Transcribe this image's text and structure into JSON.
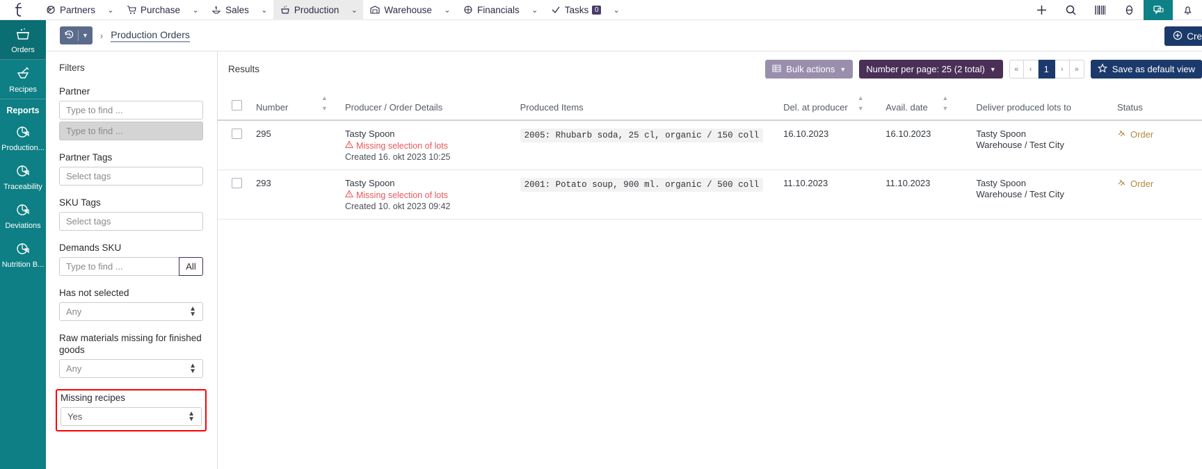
{
  "topbar": {
    "brand": "t",
    "menus": [
      {
        "label": "Partners",
        "icon": "partners-icon",
        "caret": true,
        "active": false
      },
      {
        "label": "Purchase",
        "icon": "cart-icon",
        "caret": true,
        "active": false
      },
      {
        "label": "Sales",
        "icon": "sales-icon",
        "caret": true,
        "active": false
      },
      {
        "label": "Production",
        "icon": "production-icon",
        "caret": true,
        "active": true
      },
      {
        "label": "Warehouse",
        "icon": "warehouse-icon",
        "caret": true,
        "active": false
      },
      {
        "label": "Financials",
        "icon": "financials-icon",
        "caret": true,
        "active": false
      },
      {
        "label": "Tasks",
        "icon": "check-icon",
        "caret": true,
        "active": false,
        "badge": "0"
      }
    ],
    "right_icons": [
      {
        "name": "plus-icon",
        "glyph": "+",
        "highlight": false
      },
      {
        "name": "search-icon",
        "glyph": "⌕",
        "highlight": false
      },
      {
        "name": "barcode-icon",
        "glyph": "▥",
        "highlight": false
      },
      {
        "name": "help-icon",
        "glyph": "◍",
        "highlight": false
      },
      {
        "name": "chat-icon",
        "glyph": "▢",
        "highlight": true
      },
      {
        "name": "bell-icon",
        "glyph": "◔",
        "highlight": false
      }
    ]
  },
  "rail": {
    "items": [
      {
        "label": "Orders",
        "icon": "pot-icon",
        "selected": true
      },
      {
        "label": "Recipes",
        "icon": "mortar-icon",
        "selected": false
      }
    ],
    "section_label": "Reports",
    "report_items": [
      {
        "label": "Production...",
        "icon": "pie-chart-icon"
      },
      {
        "label": "Traceability",
        "icon": "pie-chart-icon"
      },
      {
        "label": "Deviations",
        "icon": "pie-chart-icon"
      },
      {
        "label": "Nutrition B...",
        "icon": "pie-chart-icon"
      }
    ]
  },
  "breadcrumb": {
    "history_icon": "history-icon",
    "separator": "›",
    "current": "Production Orders",
    "create_label": "Cre",
    "create_icon": "plus-circle-icon"
  },
  "filters": {
    "title": "Filters",
    "partner": {
      "label": "Partner",
      "input_placeholder": "Type to find ...",
      "input_value": "",
      "second_placeholder": "Type to find ...",
      "second_value": ""
    },
    "partner_tags": {
      "label": "Partner Tags",
      "placeholder": "Select tags",
      "value": ""
    },
    "sku_tags": {
      "label": "SKU Tags",
      "placeholder": "Select tags",
      "value": ""
    },
    "demands_sku": {
      "label": "Demands SKU",
      "placeholder": "Type to find ...",
      "value": "",
      "all_label": "All"
    },
    "has_not_selected": {
      "label": "Has not selected",
      "value": "Any"
    },
    "raw_materials": {
      "label": "Raw materials missing for finished goods",
      "value": "Any"
    },
    "missing_recipes": {
      "label": "Missing recipes",
      "value": "Yes",
      "highlight_color": "#ff0000"
    }
  },
  "results": {
    "title": "Results",
    "bulk_actions_label": "Bulk actions",
    "bulk_actions_icon": "table-icon",
    "per_page_label": "Number per page: 25 (2 total)",
    "pager": [
      "«",
      "‹",
      "1",
      "›",
      "»"
    ],
    "pager_current": "1",
    "save_view_label": "Save as default view",
    "save_view_icon": "star-icon",
    "columns": [
      "Number",
      "Producer / Order Details",
      "Produced Items",
      "Del. at producer",
      "Avail. date",
      "Deliver produced lots to",
      "Status"
    ],
    "rows": [
      {
        "number": "295",
        "producer": "Tasty Spoon",
        "warning": "Missing selection of lots",
        "created": "Created 16. okt 2023 10:25",
        "produced_items": "2005: Rhubarb soda, 25 cl, organic / 150 coll",
        "del_at_producer": "16.10.2023",
        "avail_date": "16.10.2023",
        "deliver_line1": "Tasty Spoon",
        "deliver_line2": "Warehouse / Test City",
        "status": "Order"
      },
      {
        "number": "293",
        "producer": "Tasty Spoon",
        "warning": "Missing selection of lots",
        "created": "Created 10. okt 2023 09:42",
        "produced_items": "2001: Potato soup, 900 ml. organic / 500 coll",
        "del_at_producer": "11.10.2023",
        "avail_date": "11.10.2023",
        "deliver_line1": "Tasty Spoon",
        "deliver_line2": "Warehouse / Test City",
        "status": "Order"
      }
    ]
  },
  "colors": {
    "teal": "#0e7f84",
    "navy": "#1b3a6b",
    "plum": "#4a2f57",
    "lilac": "#998fad",
    "warn_red": "#e8575c",
    "status_gold": "#b08a3e",
    "highlight_red": "#ff0000"
  }
}
